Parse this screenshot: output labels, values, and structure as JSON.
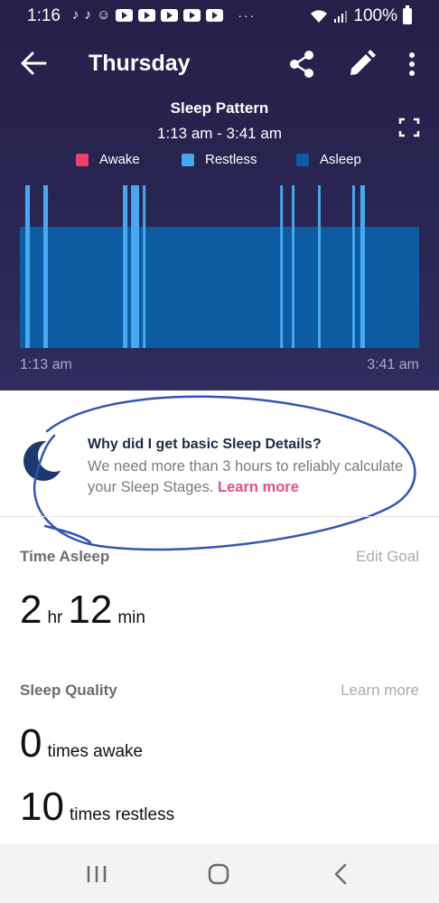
{
  "status_bar": {
    "time": "1:16",
    "battery": "100%",
    "more": "···"
  },
  "app_bar": {
    "title": "Thursday",
    "icons": [
      "arrow-back-icon",
      "share-icon",
      "pencil-icon",
      "more-vert-icon"
    ]
  },
  "chart_header": {
    "title": "Sleep Pattern",
    "range": "1:13 am - 3:41 am"
  },
  "legend": [
    {
      "label": "Awake",
      "color": "#ee3e6e"
    },
    {
      "label": "Restless",
      "color": "#45a8f0"
    },
    {
      "label": "Asleep",
      "color": "#0d5ba0"
    }
  ],
  "chart_data": {
    "type": "timeline",
    "x_start": "1:13 am",
    "x_end": "3:41 am",
    "x_range_minutes": [
      0,
      148
    ],
    "base_state": "Asleep",
    "segments": [
      {
        "state": "Restless",
        "start_min": 2.0,
        "end_min": 3.7
      },
      {
        "state": "Restless",
        "start_min": 8.7,
        "end_min": 10.4
      },
      {
        "state": "Restless",
        "start_min": 38.2,
        "end_min": 39.9
      },
      {
        "state": "Restless",
        "start_min": 41.2,
        "end_min": 44.2
      },
      {
        "state": "Restless",
        "start_min": 45.6,
        "end_min": 46.6
      },
      {
        "state": "Restless",
        "start_min": 96.5,
        "end_min": 97.5
      },
      {
        "state": "Restless",
        "start_min": 100.8,
        "end_min": 101.8
      },
      {
        "state": "Restless",
        "start_min": 110.5,
        "end_min": 111.5
      },
      {
        "state": "Restless",
        "start_min": 123.2,
        "end_min": 124.2
      },
      {
        "state": "Restless",
        "start_min": 126.2,
        "end_min": 127.9
      }
    ]
  },
  "sleep_tip": {
    "heading": "Why did I get basic Sleep Details?",
    "body": "We need more than 3 hours to reliably calculate your Sleep Stages.",
    "link": "Learn more"
  },
  "time_asleep": {
    "label": "Time Asleep",
    "action": "Edit Goal",
    "hours": "2",
    "hours_unit": "hr",
    "minutes": "12",
    "minutes_unit": "min"
  },
  "sleep_quality": {
    "label": "Sleep Quality",
    "action": "Learn more",
    "awake_count": "0",
    "awake_label": "times awake",
    "restless_count": "10",
    "restless_label": "times restless"
  },
  "nav_bar": {
    "icons": [
      "recent-apps-icon",
      "home-icon",
      "back-icon"
    ]
  }
}
